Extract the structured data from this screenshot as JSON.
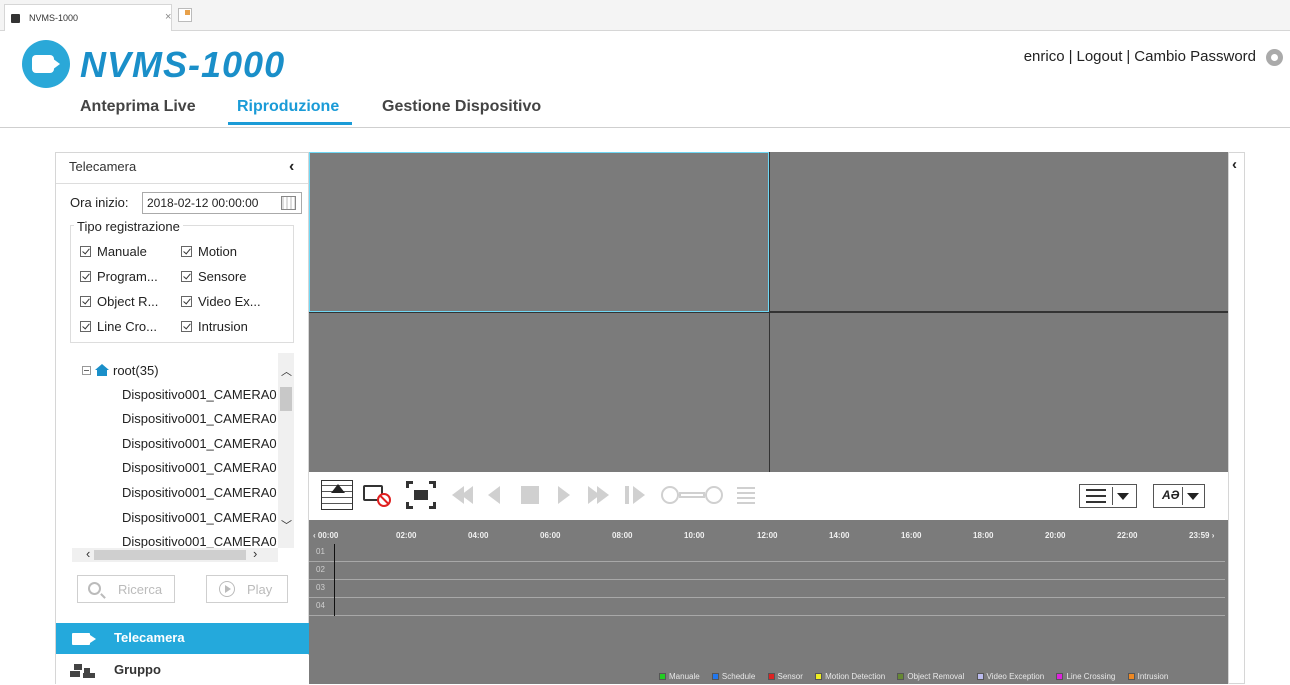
{
  "browser": {
    "tab_title": "NVMS-1000",
    "tab_close": "×"
  },
  "header": {
    "logo_text": "NVMS-1000",
    "user": "enrico",
    "sep": "|",
    "logout": "Logout",
    "change_password": "Cambio Password"
  },
  "nav": {
    "tabs": [
      "Anteprima Live",
      "Riproduzione",
      "Gestione Dispositivo"
    ],
    "active": "Riproduzione"
  },
  "left_panel": {
    "title": "Telecamera",
    "collapse": "‹",
    "start_time_label": "Ora inizio:",
    "start_time_value": "2018-02-12 00:00:00",
    "record_type_title": "Tipo registrazione",
    "record_types": [
      {
        "label": "Manuale",
        "checked": true
      },
      {
        "label": "Motion",
        "checked": true
      },
      {
        "label": "Program...",
        "checked": true
      },
      {
        "label": "Sensore",
        "checked": true
      },
      {
        "label": "Object R...",
        "checked": true
      },
      {
        "label": "Video Ex...",
        "checked": true
      },
      {
        "label": "Line Cro...",
        "checked": true
      },
      {
        "label": "Intrusion",
        "checked": true
      }
    ],
    "tree_root": "root(35)",
    "tree_items": [
      "Dispositivo001_CAMERA0",
      "Dispositivo001_CAMERA0",
      "Dispositivo001_CAMERA0",
      "Dispositivo001_CAMERA0",
      "Dispositivo001_CAMERA0",
      "Dispositivo001_CAMERA0",
      "Dispositivo001_CAMERA0"
    ],
    "search_button": "Ricerca",
    "play_button": "Play",
    "side_tabs": [
      "Telecamera",
      "Gruppo"
    ]
  },
  "toolbar": {
    "ai_label": "AƏ"
  },
  "timeline": {
    "ticks": [
      "00:00",
      "02:00",
      "04:00",
      "06:00",
      "08:00",
      "10:00",
      "12:00",
      "14:00",
      "16:00",
      "18:00",
      "20:00",
      "22:00",
      "23:59"
    ],
    "rows": [
      "01",
      "02",
      "03",
      "04"
    ],
    "legend": [
      {
        "label": "Manuale",
        "color": "#22cc22"
      },
      {
        "label": "Schedule",
        "color": "#2277ee"
      },
      {
        "label": "Sensor",
        "color": "#dd2222"
      },
      {
        "label": "Motion Detection",
        "color": "#eeee22"
      },
      {
        "label": "Object Removal",
        "color": "#668833"
      },
      {
        "label": "Video Exception",
        "color": "#bbbbee"
      },
      {
        "label": "Line Crossing",
        "color": "#dd22dd"
      },
      {
        "label": "Intrusion",
        "color": "#ee8822"
      }
    ]
  },
  "colors": {
    "accent": "#24a9dc",
    "video_bg": "#7b7b7b",
    "selected_pane_border": "#6fd8f5"
  }
}
